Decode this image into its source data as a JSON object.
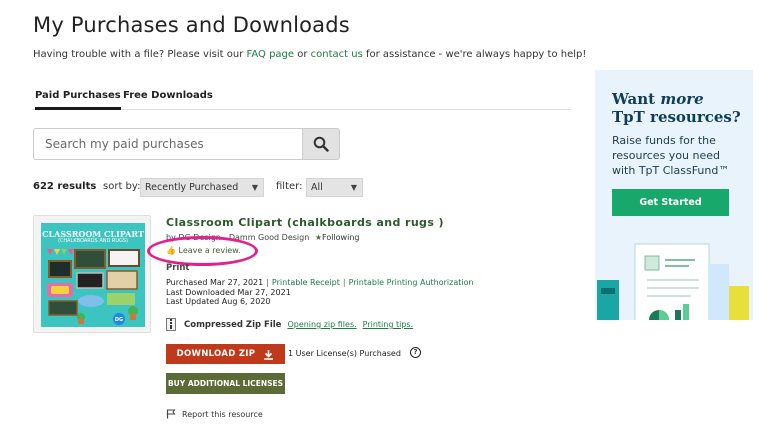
{
  "page": {
    "title": "My Purchases and Downloads",
    "help_prefix": "Having trouble with a file? Please visit our ",
    "faq_link": "FAQ page",
    "help_mid": " or ",
    "contact_link": "contact us",
    "help_suffix": " for assistance - we're always happy to help!"
  },
  "tabs": [
    {
      "label": "Paid Purchases",
      "active": true
    },
    {
      "label": "Free Downloads",
      "active": false
    }
  ],
  "search": {
    "placeholder": "Search my paid purchases",
    "icon": "search-icon"
  },
  "results": {
    "count": "622 results",
    "sort_label": "sort by:",
    "sort_value": "Recently Purchased",
    "filter_label": "filter:",
    "filter_value": "All"
  },
  "product": {
    "title": "Classroom Clipart (chalkboards and rugs )",
    "author_line": "by DG Design - Damm Good Design",
    "following": "Following",
    "review": "Leave a review.",
    "format": "Print",
    "thumb_title": "CLASSROOM CLIPART",
    "thumb_subtitle": "(CHALKBOARDS AND RUGS)",
    "thumb_badge": "DG",
    "purchased": "Purchased Mar 27, 2021",
    "printable_receipt": "Printable Receipt",
    "printable_auth": "Printable Printing Authorization",
    "last_downloaded": "Last Downloaded Mar 27, 2021",
    "last_updated": "Last Updated Aug 6, 2020",
    "file_type": "Compressed Zip File",
    "opening_zip": "Opening zip files.",
    "printing_tips": "Printing tips.",
    "download_label": "DOWNLOAD ZIP",
    "license_text": "1 User License(s) Purchased",
    "help_glyph": "?",
    "buy_label": "BUY ADDITIONAL LICENSES",
    "report_label": "Report this resource",
    "sep": "|"
  },
  "ad": {
    "headline_a": "Want ",
    "headline_em": "more",
    "headline_b": "TpT resources?",
    "body": "Raise funds for the resources you need with TpT ClassFund™",
    "button": "Get Started"
  },
  "colors": {
    "link_green": "#1f7a4a",
    "download_red": "#c0391b",
    "buy_olive": "#5a6b35",
    "ad_bg": "#e9f3fb",
    "ad_button": "#18a86b",
    "highlight_pink": "#e2208e"
  }
}
